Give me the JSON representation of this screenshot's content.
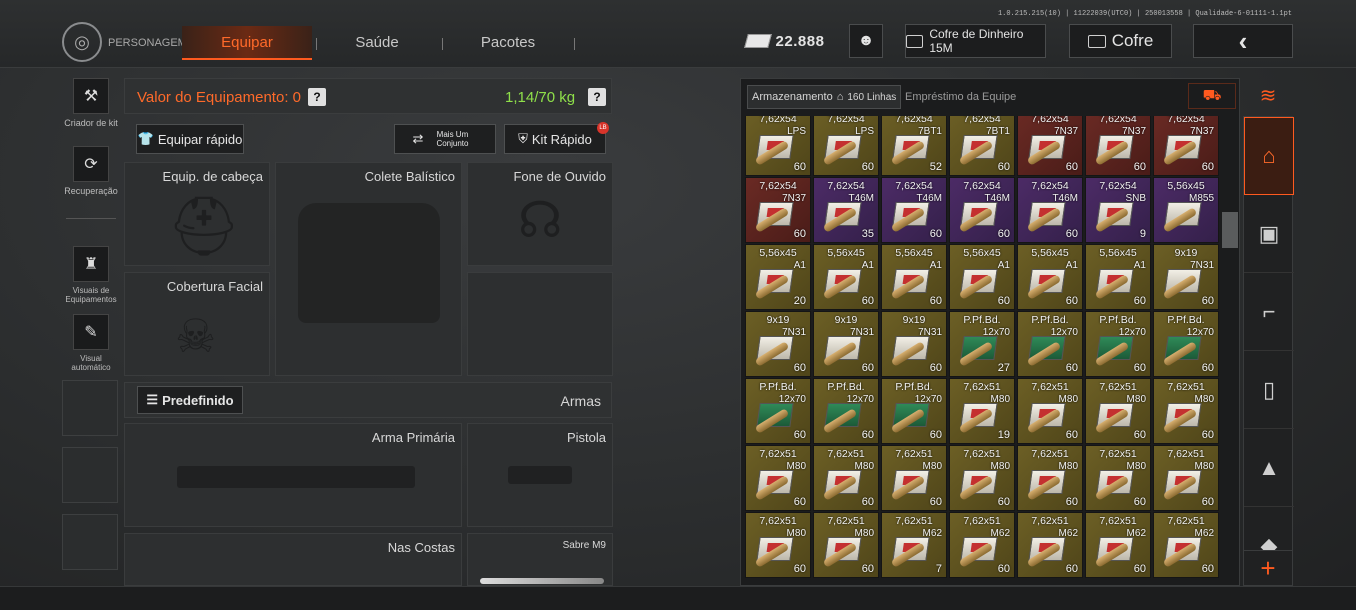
{
  "version": "1.0.215.215(10) | 11222039(UTC0) | 250013558 | Qualidade-6-01111-1.1pt",
  "nav": {
    "profile_label": "PERSONAGEM",
    "tabs": [
      "Equipar",
      "Saúde",
      "Pacotes"
    ],
    "active_tab": "Equipar"
  },
  "topbar": {
    "money": "22.888",
    "safe_label": "Cofre de Dinheiro 15M",
    "vault_label": "Cofre",
    "back_icon": "chevron-left-icon"
  },
  "sidebar": {
    "items": [
      {
        "label": "Criador de kit",
        "icon": "kit-creator-icon"
      },
      {
        "label": "Recuperação",
        "icon": "recovery-icon"
      },
      {
        "label": "Visuais de Equipamentos",
        "icon": "gear-visuals-icon"
      },
      {
        "label": "Visual automático",
        "icon": "auto-visual-icon"
      }
    ]
  },
  "loadout": {
    "value_label": "Valor do Equipamento: 0",
    "weight": "1,14/70 kg",
    "quick_equip": "Equipar rápido",
    "more_set": "Mais Um Conjunto",
    "quick_kit": "Kit Rápido",
    "quick_kit_badge": "LB",
    "slots": {
      "head": "Equip. de cabeça",
      "vest": "Colete Balístico",
      "headset": "Fone de Ouvido",
      "face": "Cobertura Facial",
      "primary": "Arma Primária",
      "pistol": "Pistola",
      "back": "Nas Costas",
      "melee": "Sabre M9"
    },
    "preset": "Predefinido",
    "weapons_label": "Armas"
  },
  "inventory": {
    "storage_label": "Armazenamento",
    "rows_label": "160 Linhas",
    "team_loan": "Empréstimo da Equipe",
    "items": [
      [
        {
          "n": "7,62x54",
          "s": "LPS",
          "q": "60",
          "c": "yel",
          "t": "rd"
        },
        {
          "n": "7,62x54",
          "s": "LPS",
          "q": "60",
          "c": "yel",
          "t": "rd"
        },
        {
          "n": "7,62x54",
          "s": "7BT1",
          "q": "52",
          "c": "yel",
          "t": "rd"
        },
        {
          "n": "7,62x54",
          "s": "7BT1",
          "q": "60",
          "c": "yel",
          "t": "rd"
        },
        {
          "n": "7,62x54",
          "s": "7N37",
          "q": "60",
          "c": "red",
          "t": "rd"
        },
        {
          "n": "7,62x54",
          "s": "7N37",
          "q": "60",
          "c": "red",
          "t": "rd"
        },
        {
          "n": "7,62x54",
          "s": "7N37",
          "q": "60",
          "c": "red",
          "t": "rd"
        }
      ],
      [
        {
          "n": "7,62x54",
          "s": "7N37",
          "q": "60",
          "c": "red",
          "t": "rd"
        },
        {
          "n": "7,62x54",
          "s": "T46M",
          "q": "35",
          "c": "pur",
          "t": "rd"
        },
        {
          "n": "7,62x54",
          "s": "T46M",
          "q": "60",
          "c": "pur",
          "t": "rd"
        },
        {
          "n": "7,62x54",
          "s": "T46M",
          "q": "60",
          "c": "pur",
          "t": "rd"
        },
        {
          "n": "7,62x54",
          "s": "T46M",
          "q": "60",
          "c": "pur",
          "t": "rd"
        },
        {
          "n": "7,62x54",
          "s": "SNB",
          "q": "9",
          "c": "pur",
          "t": "rd"
        },
        {
          "n": "5,56x45",
          "s": "M855",
          "q": "",
          "c": "pur",
          "t": "w"
        }
      ],
      [
        {
          "n": "5,56x45",
          "s": "A1",
          "q": "20",
          "c": "yel",
          "t": "rd"
        },
        {
          "n": "5,56x45",
          "s": "A1",
          "q": "60",
          "c": "yel",
          "t": "rd"
        },
        {
          "n": "5,56x45",
          "s": "A1",
          "q": "60",
          "c": "yel",
          "t": "rd"
        },
        {
          "n": "5,56x45",
          "s": "A1",
          "q": "60",
          "c": "yel",
          "t": "rd"
        },
        {
          "n": "5,56x45",
          "s": "A1",
          "q": "60",
          "c": "yel",
          "t": "rd"
        },
        {
          "n": "5,56x45",
          "s": "A1",
          "q": "60",
          "c": "yel",
          "t": "rd"
        },
        {
          "n": "9x19",
          "s": "7N31",
          "q": "60",
          "c": "yel",
          "t": "w"
        }
      ],
      [
        {
          "n": "9x19",
          "s": "7N31",
          "q": "60",
          "c": "yel",
          "t": "w"
        },
        {
          "n": "9x19",
          "s": "7N31",
          "q": "60",
          "c": "yel",
          "t": "w"
        },
        {
          "n": "9x19",
          "s": "7N31",
          "q": "60",
          "c": "yel",
          "t": "w"
        },
        {
          "n": "P.Pf.Bd.",
          "s": "12x70",
          "q": "27",
          "c": "yel",
          "t": "g"
        },
        {
          "n": "P.Pf.Bd.",
          "s": "12x70",
          "q": "60",
          "c": "yel",
          "t": "g"
        },
        {
          "n": "P.Pf.Bd.",
          "s": "12x70",
          "q": "60",
          "c": "yel",
          "t": "g"
        },
        {
          "n": "P.Pf.Bd.",
          "s": "12x70",
          "q": "60",
          "c": "yel",
          "t": "g"
        }
      ],
      [
        {
          "n": "P.Pf.Bd.",
          "s": "12x70",
          "q": "60",
          "c": "yel",
          "t": "g"
        },
        {
          "n": "P.Pf.Bd.",
          "s": "12x70",
          "q": "60",
          "c": "yel",
          "t": "g"
        },
        {
          "n": "P.Pf.Bd.",
          "s": "12x70",
          "q": "60",
          "c": "yel",
          "t": "g"
        },
        {
          "n": "7,62x51",
          "s": "M80",
          "q": "19",
          "c": "yel",
          "t": "rd"
        },
        {
          "n": "7,62x51",
          "s": "M80",
          "q": "60",
          "c": "yel",
          "t": "rd"
        },
        {
          "n": "7,62x51",
          "s": "M80",
          "q": "60",
          "c": "yel",
          "t": "rd"
        },
        {
          "n": "7,62x51",
          "s": "M80",
          "q": "60",
          "c": "yel",
          "t": "rd"
        }
      ],
      [
        {
          "n": "7,62x51",
          "s": "M80",
          "q": "60",
          "c": "yel",
          "t": "rd"
        },
        {
          "n": "7,62x51",
          "s": "M80",
          "q": "60",
          "c": "yel",
          "t": "rd"
        },
        {
          "n": "7,62x51",
          "s": "M80",
          "q": "60",
          "c": "yel",
          "t": "rd"
        },
        {
          "n": "7,62x51",
          "s": "M80",
          "q": "60",
          "c": "yel",
          "t": "rd"
        },
        {
          "n": "7,62x51",
          "s": "M80",
          "q": "60",
          "c": "yel",
          "t": "rd"
        },
        {
          "n": "7,62x51",
          "s": "M80",
          "q": "60",
          "c": "yel",
          "t": "rd"
        },
        {
          "n": "7,62x51",
          "s": "M80",
          "q": "60",
          "c": "yel",
          "t": "rd"
        }
      ],
      [
        {
          "n": "7,62x51",
          "s": "M80",
          "q": "60",
          "c": "yel",
          "t": "rd"
        },
        {
          "n": "7,62x51",
          "s": "M80",
          "q": "60",
          "c": "yel",
          "t": "rd"
        },
        {
          "n": "7,62x51",
          "s": "M62",
          "q": "7",
          "c": "yel",
          "t": "rd"
        },
        {
          "n": "7,62x51",
          "s": "M62",
          "q": "60",
          "c": "yel",
          "t": "rd"
        },
        {
          "n": "7,62x51",
          "s": "M62",
          "q": "60",
          "c": "yel",
          "t": "rd"
        },
        {
          "n": "7,62x51",
          "s": "M62",
          "q": "60",
          "c": "yel",
          "t": "rd"
        },
        {
          "n": "7,62x51",
          "s": "M62",
          "q": "60",
          "c": "yel",
          "t": "rd"
        }
      ]
    ]
  },
  "rail": {
    "icons": [
      "home-icon",
      "vest-icon",
      "rifle-icon",
      "magazine-icon",
      "ammo-icon",
      "backpack-icon"
    ],
    "add_label": "+"
  },
  "colors": {
    "accent": "#ff5a1f",
    "weight": "#8fe04a"
  }
}
